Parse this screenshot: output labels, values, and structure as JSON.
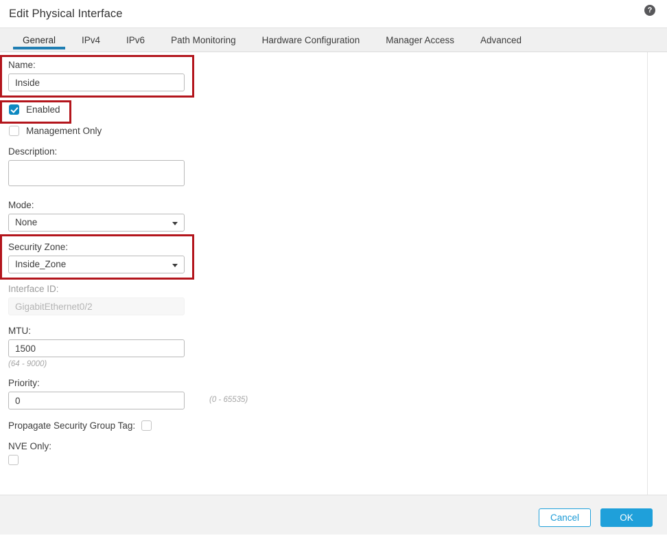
{
  "header": {
    "title": "Edit Physical Interface",
    "help_icon": "help-circle-icon",
    "help_glyph": "?"
  },
  "tabs": [
    {
      "label": "General",
      "active": true
    },
    {
      "label": "IPv4",
      "active": false
    },
    {
      "label": "IPv6",
      "active": false
    },
    {
      "label": "Path Monitoring",
      "active": false
    },
    {
      "label": "Hardware Configuration",
      "active": false
    },
    {
      "label": "Manager Access",
      "active": false
    },
    {
      "label": "Advanced",
      "active": false
    }
  ],
  "form": {
    "name_label": "Name:",
    "name_value": "Inside",
    "enabled_label": "Enabled",
    "enabled_checked": true,
    "management_only_label": "Management Only",
    "management_only_checked": false,
    "description_label": "Description:",
    "description_value": "",
    "mode_label": "Mode:",
    "mode_value": "None",
    "security_zone_label": "Security Zone:",
    "security_zone_value": "Inside_Zone",
    "interface_id_label": "Interface ID:",
    "interface_id_value": "GigabitEthernet0/2",
    "mtu_label": "MTU:",
    "mtu_value": "1500",
    "mtu_hint": "(64 - 9000)",
    "priority_label": "Priority:",
    "priority_value": "0",
    "priority_hint": "(0 - 65535)",
    "propagate_sgt_label": "Propagate Security Group Tag:",
    "propagate_sgt_checked": false,
    "nve_only_label": "NVE Only:",
    "nve_only_checked": false
  },
  "footer": {
    "cancel_label": "Cancel",
    "ok_label": "OK"
  },
  "annotations": {
    "accent_blue": "#1f7eb3",
    "checkbox_blue": "#0d89c1",
    "button_blue": "#1fa0da",
    "highlight_red": "#b3151c"
  }
}
